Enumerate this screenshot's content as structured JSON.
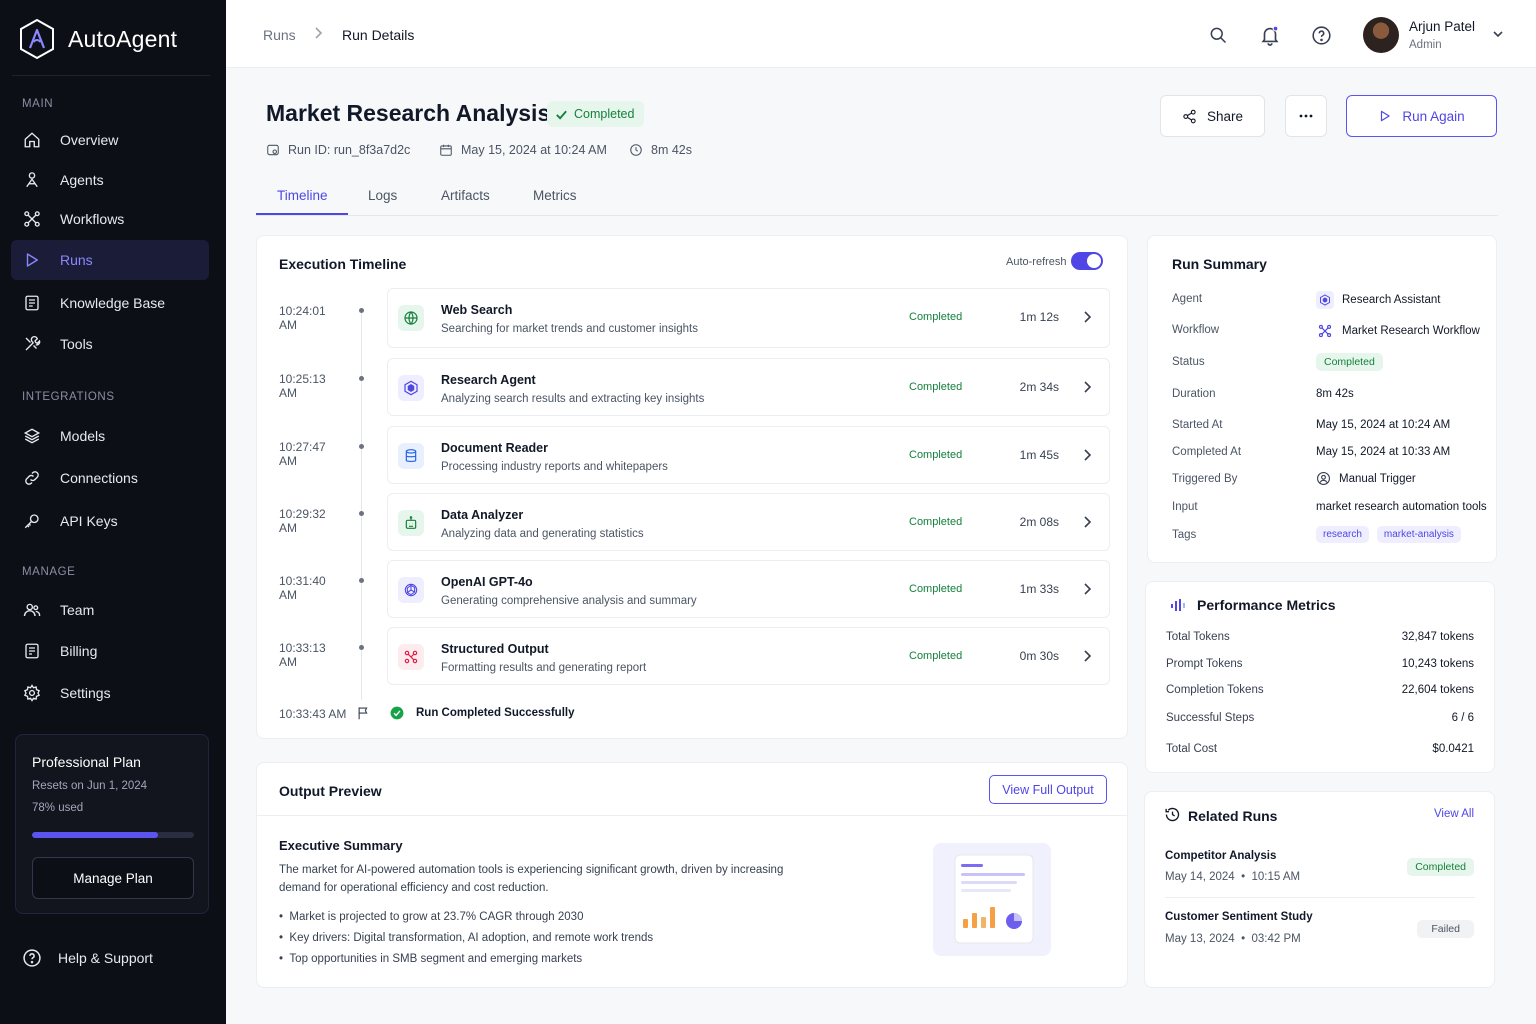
{
  "app": {
    "name": "AutoAgent"
  },
  "sidebar": {
    "sections": {
      "main": "MAIN",
      "integrations": "INTEGRATIONS",
      "manage": "MANAGE"
    },
    "items": {
      "overview": "Overview",
      "agents": "Agents",
      "workflows": "Workflows",
      "runs": "Runs",
      "knowledge": "Knowledge Base",
      "tools": "Tools",
      "models": "Models",
      "connections": "Connections",
      "api_keys": "API Keys",
      "team": "Team",
      "billing": "Billing",
      "settings": "Settings"
    },
    "active": "runs",
    "plan": {
      "title": "Professional Plan",
      "resets": "Resets on Jun 1, 2024",
      "usage_label": "78% used",
      "usage_fraction": 0.78,
      "button": "Manage Plan"
    },
    "help": "Help & Support"
  },
  "topbar": {
    "breadcrumb": [
      "Runs",
      "Run Details"
    ],
    "user": {
      "name": "Arjun Patel",
      "role": "Admin"
    }
  },
  "header": {
    "title": "Market Research Analysis",
    "status": "Completed",
    "run_id": "Run ID: run_8f3a7d2c",
    "date": "May 15, 2024 at 10:24 AM",
    "duration": "8m 42s",
    "share": "Share",
    "run_again": "Run Again"
  },
  "tabs": [
    "Timeline",
    "Logs",
    "Artifacts",
    "Metrics"
  ],
  "timeline": {
    "title": "Execution Timeline",
    "auto_refresh": "Auto-refresh",
    "auto_refresh_on": true,
    "steps": [
      {
        "time": "10:24:01 AM",
        "name": "Web Search",
        "desc": "Searching for market trends and customer insights",
        "status": "Completed",
        "duration": "1m 12s",
        "icon": "globe-icon"
      },
      {
        "time": "10:25:13 AM",
        "name": "Research Agent",
        "desc": "Analyzing search results and extracting key insights",
        "status": "Completed",
        "duration": "2m 34s",
        "icon": "hexagon-agent-icon"
      },
      {
        "time": "10:27:47 AM",
        "name": "Document Reader",
        "desc": "Processing industry reports and whitepapers",
        "status": "Completed",
        "duration": "1m 45s",
        "icon": "database-icon"
      },
      {
        "time": "10:29:32 AM",
        "name": "Data Analyzer",
        "desc": "Analyzing data and generating statistics",
        "status": "Completed",
        "duration": "2m 08s",
        "icon": "robot-icon"
      },
      {
        "time": "10:31:40 AM",
        "name": "OpenAI GPT-4o",
        "desc": "Generating comprehensive analysis and summary",
        "status": "Completed",
        "duration": "1m 33s",
        "icon": "openai-icon"
      },
      {
        "time": "10:33:13 AM",
        "name": "Structured Output",
        "desc": "Formatting results and generating report",
        "status": "Completed",
        "duration": "0m 30s",
        "icon": "nodes-icon"
      }
    ],
    "final": {
      "time": "10:33:43 AM",
      "label": "Run Completed Successfully"
    }
  },
  "output": {
    "title": "Output Preview",
    "button": "View Full Output",
    "heading": "Executive Summary",
    "paragraph_line1": "The market for AI-powered automation tools is experiencing significant growth, driven by increasing",
    "paragraph_line2": "demand for operational efficiency and cost reduction.",
    "bullets": [
      "Market is projected to grow at 23.7% CAGR through 2030",
      "Key drivers: Digital transformation, AI adoption, and remote work trends",
      "Top opportunities in SMB segment and emerging markets"
    ]
  },
  "summary": {
    "title": "Run Summary",
    "labels": {
      "agent": "Agent",
      "workflow": "Workflow",
      "status": "Status",
      "duration": "Duration",
      "started": "Started At",
      "completed": "Completed At",
      "triggered": "Triggered By",
      "input": "Input",
      "tags": "Tags"
    },
    "values": {
      "agent": "Research Assistant",
      "workflow": "Market Research Workflow",
      "status": "Completed",
      "duration": "8m 42s",
      "started": "May 15, 2024 at 10:24 AM",
      "completed": "May 15, 2024 at 10:33 AM",
      "triggered": "Manual Trigger",
      "input": "market research automation tools",
      "tags": [
        "research",
        "market-analysis"
      ]
    }
  },
  "performance": {
    "title": "Performance Metrics",
    "rows": [
      {
        "label": "Total Tokens",
        "value": "32,847 tokens"
      },
      {
        "label": "Prompt Tokens",
        "value": "10,243 tokens"
      },
      {
        "label": "Completion Tokens",
        "value": "22,604 tokens"
      },
      {
        "label": "Successful Steps",
        "value": "6 / 6"
      },
      {
        "label": "Total Cost",
        "value": "$0.0421"
      }
    ]
  },
  "related": {
    "title": "Related Runs",
    "view_all": "View All",
    "runs": [
      {
        "name": "Competitor Analysis",
        "date": "May 14, 2024",
        "time": "10:15 AM",
        "status": "Completed"
      },
      {
        "name": "Customer Sentiment Study",
        "date": "May 13, 2024",
        "time": "03:42 PM",
        "status": "Failed"
      }
    ]
  },
  "colors": {
    "accent": "#4f46e5",
    "success": "#15803d",
    "sidebar_bg": "#0d0f17"
  }
}
